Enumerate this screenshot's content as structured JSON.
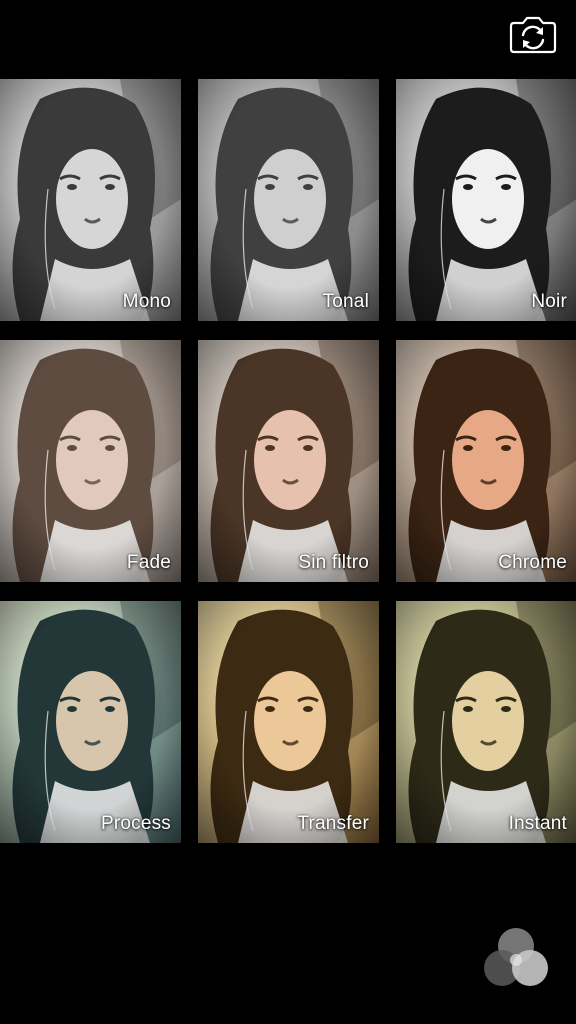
{
  "toolbar": {
    "flip_camera_icon": "camera-flip-icon"
  },
  "filters": [
    {
      "label": "Mono",
      "tone": "mono",
      "bg": "#8a8a8a",
      "hair": "#3a3a3a",
      "face": "#d6d6d6",
      "wall": "#c9c9c9"
    },
    {
      "label": "Tonal",
      "tone": "tonal",
      "bg": "#7d7d7d",
      "hair": "#404040",
      "face": "#cfcfcf",
      "wall": "#bdbdbd"
    },
    {
      "label": "Noir",
      "tone": "noir",
      "bg": "#5a5a5a",
      "hair": "#1c1c1c",
      "face": "#f0f0f0",
      "wall": "#d9d9d9"
    },
    {
      "label": "Fade",
      "tone": "fade",
      "bg": "#9a8f88",
      "hair": "#5f4c40",
      "face": "#e1c9bd",
      "wall": "#d4cfca"
    },
    {
      "label": "Sin filtro",
      "tone": "none",
      "bg": "#8d7b6c",
      "hair": "#4a3526",
      "face": "#e6c1ae",
      "wall": "#cdc6bf"
    },
    {
      "label": "Chrome",
      "tone": "chrome",
      "bg": "#7a5c44",
      "hair": "#3b2414",
      "face": "#e7a886",
      "wall": "#cfc2b4"
    },
    {
      "label": "Process",
      "tone": "process",
      "bg": "#4c6a6b",
      "hair": "#233738",
      "face": "#d7c6ab",
      "wall": "#d9e1c9"
    },
    {
      "label": "Transfer",
      "tone": "transfer",
      "bg": "#8a6a3a",
      "hair": "#3d2a12",
      "face": "#ecc797",
      "wall": "#e7d7a4"
    },
    {
      "label": "Instant",
      "tone": "instant",
      "bg": "#6d6a48",
      "hair": "#2d2a17",
      "face": "#e4cfa0",
      "wall": "#d9d5a8"
    }
  ],
  "bottom": {
    "filters_icon": "filters-circles-icon"
  }
}
